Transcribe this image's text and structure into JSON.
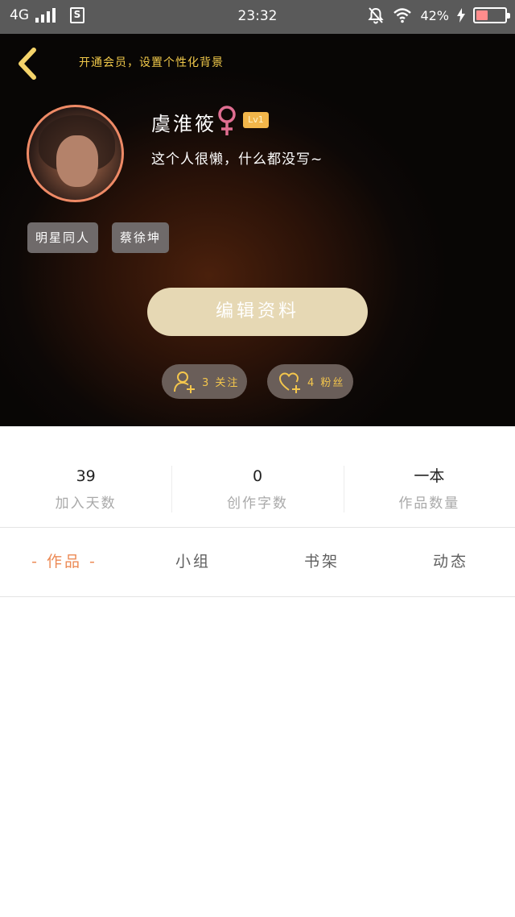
{
  "status_bar": {
    "network": "4G",
    "sim_icon": "S",
    "time": "23:32",
    "battery": "42%",
    "battery_level": 0.42,
    "icons": [
      "signal-icon",
      "sim-icon",
      "mute-bell-icon",
      "wifi-icon",
      "charging-icon",
      "battery-icon"
    ]
  },
  "header": {
    "back_icon": "chevron-left-icon",
    "vip_promo": "开通会员，设置个性化背景",
    "nickname": "虞淮筱",
    "gender_icon": "female-icon",
    "level": "Lv1",
    "bio": "这个人很懒，什么都没写~",
    "tags": [
      "明星同人",
      "蔡徐坤"
    ],
    "edit_button": "编辑资料",
    "following": "3 关注",
    "fans": "4 粉丝",
    "colors": {
      "accent": "#f1c94a",
      "avatar_ring": "#ee8a66",
      "edit_button": "#e6d8b4"
    }
  },
  "stats": [
    {
      "value": "39",
      "label": "加入天数"
    },
    {
      "value": "0",
      "label": "创作字数"
    },
    {
      "value": "一本",
      "label": "作品数量"
    }
  ],
  "tabs": {
    "active": "- 作品 -",
    "items": [
      "小组",
      "书架",
      "动态"
    ],
    "active_color": "#ec8a55"
  }
}
